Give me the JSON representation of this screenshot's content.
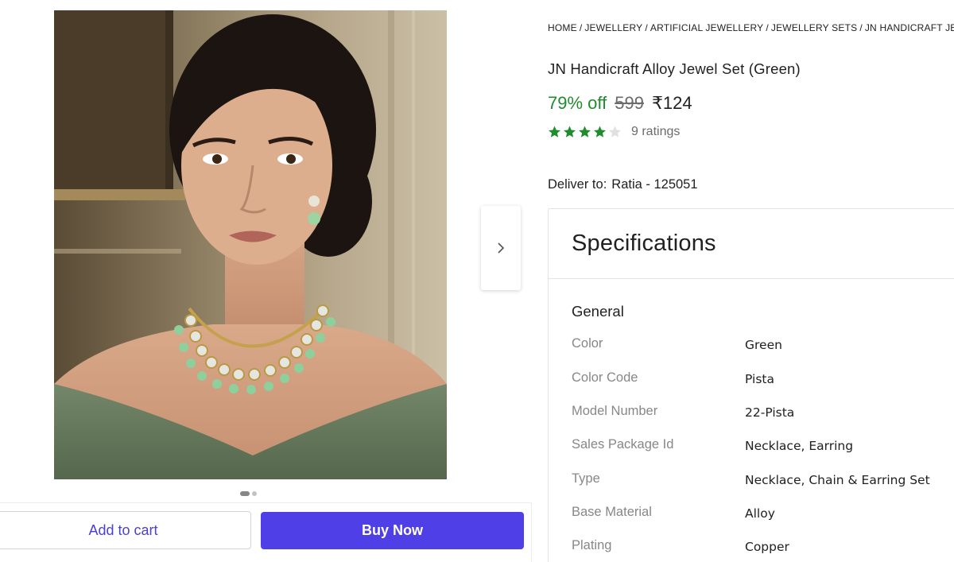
{
  "breadcrumb": [
    {
      "label": "HOME"
    },
    {
      "label": "JEWELLERY"
    },
    {
      "label": "ARTIFICIAL JEWELLERY"
    },
    {
      "label": "JEWELLERY SETS"
    },
    {
      "label": "JN HANDICRAFT JEW"
    }
  ],
  "product": {
    "title": "JN Handicraft Alloy Jewel Set (Green)",
    "discount": "79% off",
    "mrp": "599",
    "price": "₹124",
    "rating_stars": 4,
    "rating_max": 5,
    "ratings_text": "9 ratings",
    "star_color": "#1f8c2e"
  },
  "delivery": {
    "label": "Deliver to:",
    "location": "Ratia - 125051"
  },
  "gallery": {
    "image_count": 2,
    "active_index": 0
  },
  "actions": {
    "add_to_cart": "Add to cart",
    "buy_now": "Buy Now",
    "accent_color": "#4f3fe6"
  },
  "specifications": {
    "heading": "Specifications",
    "section": "General",
    "rows": [
      {
        "key": "Color",
        "value": "Green"
      },
      {
        "key": "Color Code",
        "value": "Pista"
      },
      {
        "key": "Model Number",
        "value": "22-Pista"
      },
      {
        "key": "Sales Package Id",
        "value": "Necklace, Earring"
      },
      {
        "key": "Type",
        "value": "Necklace, Chain & Earring Set"
      },
      {
        "key": "Base Material",
        "value": "Alloy"
      },
      {
        "key": "Plating",
        "value": "Copper"
      }
    ]
  }
}
